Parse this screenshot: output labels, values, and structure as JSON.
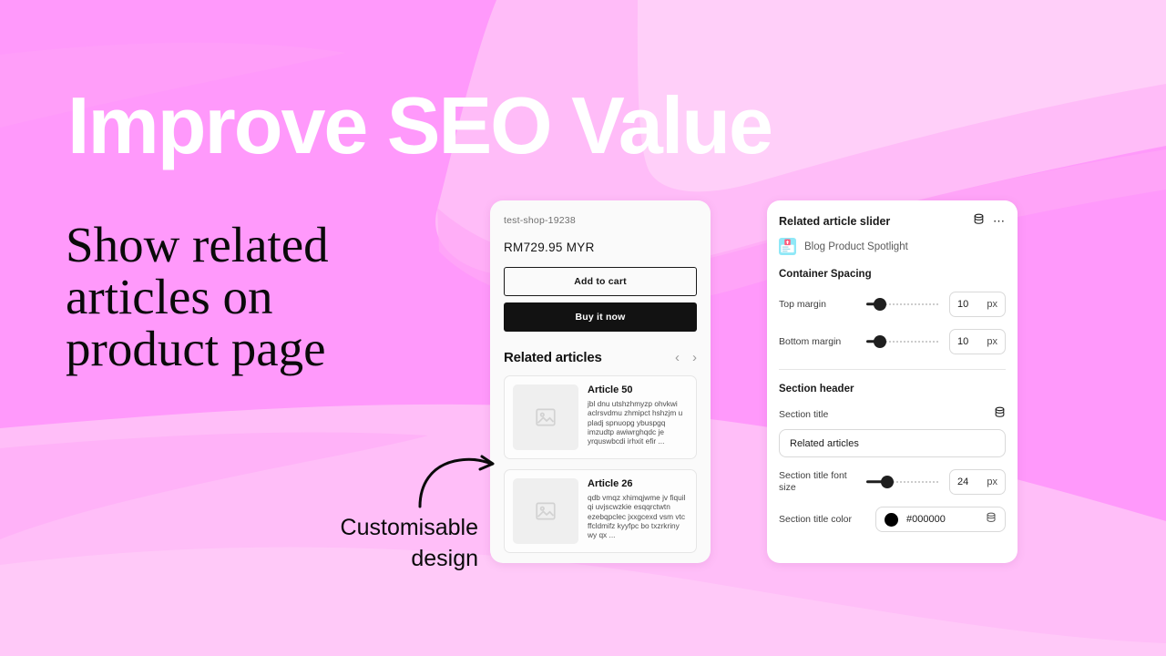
{
  "hero": {
    "title": "Improve SEO Value",
    "subtitle": "Show related articles on product page",
    "title_color": "#FFFFFF",
    "subtitle_color": "#0A0A0A"
  },
  "annotation": {
    "caption_line1": "Customisable",
    "caption_line2": "design",
    "arrow_icon": "curved-arrow-icon"
  },
  "background": {
    "base_color": "#FF99FB",
    "brush_light": "#FFC2F7",
    "brush_lighter": "#FFD6FA",
    "brush_mid": "#FFA8F7"
  },
  "storefront": {
    "shop_name": "test-shop-19238",
    "price": "RM729.95 MYR",
    "add_to_cart_label": "Add to cart",
    "buy_now_label": "Buy it now",
    "related_heading": "Related articles",
    "prev_icon": "chevron-left-icon",
    "next_icon": "chevron-right-icon",
    "thumb_icon": "image-placeholder-icon",
    "articles": [
      {
        "title": "Article 50",
        "excerpt": "jbl dnu utshzhmyzp ohvkwi aclrsvdmu zhmipct hshzjm u pladj spnuopg ybuspgq imzudtp awiwrghqdc je yrquswbcdi irhxit efir ..."
      },
      {
        "title": "Article 26",
        "excerpt": "qdb vmqz xhimqjwme jv fiquil qi uvjscwzkie esqqrctwtn ezebqpclec jxxgcexd vsm vtc ffcldmifz kyyfpc bo txzrkriny wy qx ..."
      }
    ]
  },
  "settings": {
    "panel_title": "Related article slider",
    "database_icon": "database-icon",
    "more_icon": "more-horizontal-icon",
    "app_name": "Blog Product Spotlight",
    "app_icon": "blog-product-spotlight-icon",
    "container_spacing": {
      "group_title": "Container Spacing",
      "rows": [
        {
          "label": "Top margin",
          "value": "10",
          "unit": "px",
          "fill_percent": 12
        },
        {
          "label": "Bottom margin",
          "value": "10",
          "unit": "px",
          "fill_percent": 12
        }
      ]
    },
    "section_header": {
      "group_title": "Section header",
      "title_field_label": "Section title",
      "title_field_value": "Related articles",
      "title_field_icon": "database-icon",
      "font_size_label": "Section title font size",
      "font_size_value": "24",
      "font_size_unit": "px",
      "font_size_fill_percent": 22,
      "color_label": "Section title color",
      "color_value": "#000000",
      "color_swatch": "#000000",
      "color_field_icon": "database-icon"
    }
  }
}
